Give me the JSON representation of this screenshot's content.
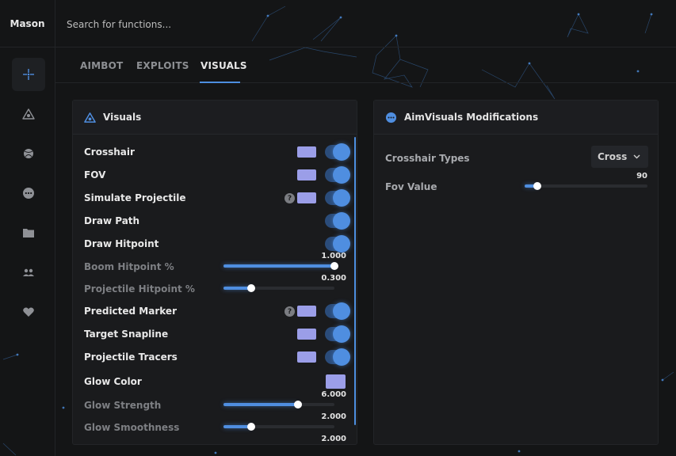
{
  "app": {
    "brand": "Mason"
  },
  "search": {
    "placeholder": "Search for functions..."
  },
  "tabs": [
    {
      "label": "AIMBOT",
      "active": false
    },
    {
      "label": "EXPLOITS",
      "active": false
    },
    {
      "label": "VISUALS",
      "active": true
    }
  ],
  "sidebar": {
    "items": [
      {
        "icon": "crosshair-icon",
        "active": true
      },
      {
        "icon": "eye-triangle-icon",
        "active": false
      },
      {
        "icon": "ball-icon",
        "active": false
      },
      {
        "icon": "ellipsis-icon",
        "active": false
      },
      {
        "icon": "folder-icon",
        "active": false
      },
      {
        "icon": "users-icon",
        "active": false
      },
      {
        "icon": "heart-icon",
        "active": false
      }
    ]
  },
  "visuals_panel": {
    "title": "Visuals",
    "rows": {
      "crosshair": {
        "label": "Crosshair",
        "enabled": true
      },
      "fov": {
        "label": "FOV",
        "enabled": true
      },
      "simulate_projectile": {
        "label": "Simulate Projectile",
        "enabled": true,
        "help": "?"
      },
      "draw_path": {
        "label": "Draw Path",
        "enabled": true
      },
      "draw_hitpoint": {
        "label": "Draw Hitpoint",
        "enabled": true
      },
      "boom_hitpoint": {
        "label": "Boom Hitpoint %",
        "value_text": "1.000",
        "fraction": 1.0
      },
      "projectile_hitpoint": {
        "label": "Projectile Hitpoint %",
        "value_text": "0.300",
        "fraction": 0.25
      },
      "predicted_marker": {
        "label": "Predicted Marker",
        "enabled": true,
        "help": "?"
      },
      "target_snapline": {
        "label": "Target Snapline",
        "enabled": true
      },
      "projectile_tracers": {
        "label": "Projectile Tracers",
        "enabled": true
      },
      "glow_color": {
        "label": "Glow Color"
      },
      "glow_strength": {
        "label": "Glow Strength",
        "value_text": "6.000",
        "fraction": 0.67
      },
      "glow_smoothness": {
        "label": "Glow Smoothness",
        "value_text": "2.000",
        "fraction": 0.25
      },
      "next_value": {
        "value_text": "2.000"
      }
    }
  },
  "aim_panel": {
    "title": "AimVisuals Modifications",
    "crosshair_types": {
      "label": "Crosshair Types",
      "selected": "Cross"
    },
    "fov_value": {
      "label": "Fov Value",
      "value_text": "90",
      "fraction": 0.1
    }
  },
  "colors": {
    "accent": "#4f8ee0",
    "swatch": "#9b9ee8",
    "background": "#141516",
    "panel": "#1a1b1d"
  }
}
